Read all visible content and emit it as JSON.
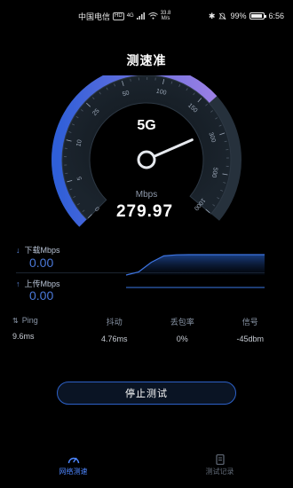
{
  "status_bar": {
    "carrier": "中国电信",
    "hd_badge": "HD",
    "net_type": "4G",
    "net_speed": "33.8",
    "net_speed_unit": "M/s",
    "battery": "99%",
    "time": "6:56"
  },
  "app": {
    "title": "测速准"
  },
  "gauge": {
    "network_type": "5G",
    "unit": "Mbps",
    "speed": "279.97",
    "scale_labels": [
      "0",
      "5",
      "10",
      "25",
      "50",
      "100",
      "150",
      "300",
      "500",
      "1000"
    ],
    "scale_fractions": [
      0,
      0.111,
      0.222,
      0.333,
      0.444,
      0.556,
      0.667,
      0.778,
      0.889,
      1
    ],
    "needle_fraction": 0.76,
    "progress_fraction": 0.69,
    "colors": {
      "start": "#2f5fd8",
      "end": "#9a7fe4",
      "track": "#26313c"
    }
  },
  "download": {
    "label": "下载Mbps",
    "value": "0.00",
    "icon": "arrow-down-icon"
  },
  "upload": {
    "label": "上传Mbps",
    "value": "0.00",
    "icon": "arrow-up-icon"
  },
  "chart_data": {
    "type": "area",
    "series": [
      {
        "values": [
          0,
          0.15,
          0.6,
          0.9,
          0.95,
          0.96,
          0.96,
          0.96,
          0.96,
          0.96,
          0.96,
          0.96
        ]
      },
      {
        "values": [
          0,
          0,
          0,
          0,
          0,
          0,
          0,
          0,
          0,
          0,
          0,
          0
        ]
      }
    ]
  },
  "metrics": [
    {
      "label": "Ping",
      "value": "9.6ms",
      "icon": "ping-icon"
    },
    {
      "label": "抖动",
      "value": "4.76ms"
    },
    {
      "label": "丢包率",
      "value": "0%"
    },
    {
      "label": "信号",
      "value": "-45dbm"
    }
  ],
  "stop_button": {
    "label": "停止测试"
  },
  "bottom_nav": [
    {
      "label": "网络测速",
      "icon": "speedometer-icon",
      "active": true
    },
    {
      "label": "测试记录",
      "icon": "record-icon",
      "active": false
    }
  ],
  "colors": {
    "accent": "#4d86ff",
    "value_blue": "#4a78d8",
    "background": "#000000"
  }
}
